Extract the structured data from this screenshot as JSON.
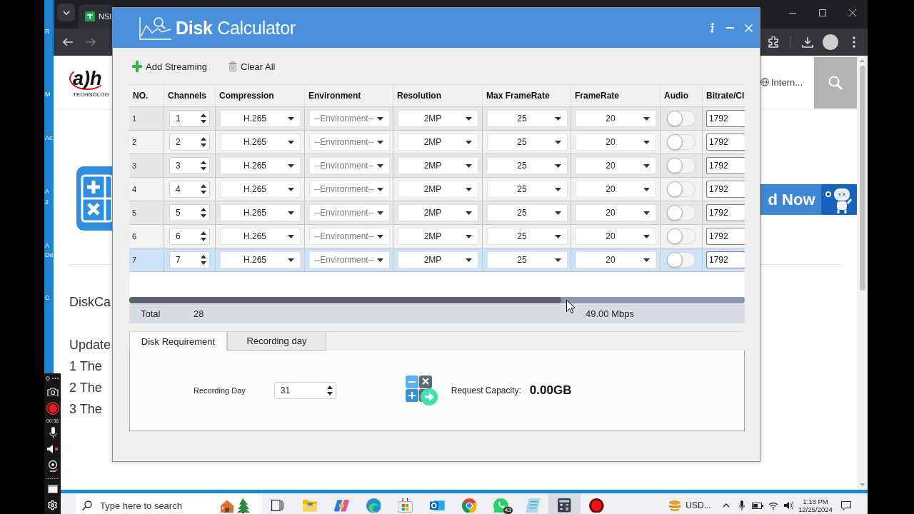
{
  "desktop": {
    "icon_labels": [
      "R",
      "M",
      "Ac",
      "A",
      "2",
      "A",
      "De",
      "C"
    ]
  },
  "browser": {
    "tab": {
      "title": "NSI"
    },
    "page": {
      "logo": {
        "text": "a)h",
        "tagline": "TECHNOLOG"
      },
      "search_scope": "Intern...",
      "banner": "d Now",
      "texts": [
        "DiskCa",
        "Update",
        "1 The",
        "2 The",
        "3 The"
      ]
    }
  },
  "dialog": {
    "title": "**Disk** Calculator",
    "toolbar": [
      {
        "kind": "add",
        "label": "Add Streaming"
      },
      {
        "kind": "clear",
        "label": "Clear All"
      }
    ],
    "table": {
      "columns": [
        "NO.",
        "Channels",
        "Compression",
        "Environment",
        "Resolution",
        "Max FrameRate",
        "FrameRate",
        "Audio",
        "Bitrate/Cl"
      ],
      "rows": [
        {
          "no": "1",
          "channels": "1",
          "compression": "H.265",
          "environment": {
            "placeholder": "--Environment--"
          },
          "resolution": "2MP",
          "max_framerate": "25",
          "framerate": "20",
          "audio": false,
          "bitrate": "1792",
          "selected": false
        },
        {
          "no": "2",
          "channels": "2",
          "compression": "H.265",
          "environment": {
            "placeholder": "--Environment--"
          },
          "resolution": "2MP",
          "max_framerate": "25",
          "framerate": "20",
          "audio": false,
          "bitrate": "1792",
          "selected": false
        },
        {
          "no": "3",
          "channels": "3",
          "compression": "H.265",
          "environment": {
            "placeholder": "--Environment--"
          },
          "resolution": "2MP",
          "max_framerate": "25",
          "framerate": "20",
          "audio": false,
          "bitrate": "1792",
          "selected": false
        },
        {
          "no": "4",
          "channels": "4",
          "compression": "H.265",
          "environment": {
            "placeholder": "--Environment--"
          },
          "resolution": "2MP",
          "max_framerate": "25",
          "framerate": "20",
          "audio": false,
          "bitrate": "1792",
          "selected": false
        },
        {
          "no": "5",
          "channels": "5",
          "compression": "H.265",
          "environment": {
            "placeholder": "--Environment--"
          },
          "resolution": "2MP",
          "max_framerate": "25",
          "framerate": "20",
          "audio": false,
          "bitrate": "1792",
          "selected": false
        },
        {
          "no": "6",
          "channels": "6",
          "compression": "H.265",
          "environment": {
            "placeholder": "--Environment--"
          },
          "resolution": "2MP",
          "max_framerate": "25",
          "framerate": "20",
          "audio": false,
          "bitrate": "1792",
          "selected": false
        },
        {
          "no": "7",
          "channels": "7",
          "compression": "H.265",
          "environment": {
            "placeholder": "--Environment--"
          },
          "resolution": "2MP",
          "max_framerate": "25",
          "framerate": "20",
          "audio": false,
          "bitrate": "1792",
          "selected": true
        }
      ]
    },
    "total": {
      "label": "Total",
      "channels": "28",
      "bitrate": "49.00 Mbps"
    },
    "tabs": [
      {
        "label": "Disk Requirement",
        "selected": true
      },
      {
        "label": "Recording day",
        "selected": false
      }
    ],
    "panel": {
      "recording_day_label": "Recording Day",
      "recording_day": "31",
      "capacity_label": "Request Capacity:",
      "capacity": "0.00GB"
    }
  },
  "recorder": {
    "elapsed": "00:36"
  },
  "taskbar": {
    "search": {
      "placeholder": "Type here to search"
    },
    "apps": [
      {
        "kind": "taskview",
        "selected": false
      },
      {
        "kind": "explorer",
        "selected": false
      },
      {
        "kind": "copilot",
        "selected": false
      },
      {
        "kind": "edge",
        "selected": false
      },
      {
        "kind": "store",
        "selected": false
      },
      {
        "kind": "outlook",
        "selected": false
      },
      {
        "kind": "chrome",
        "selected": false
      },
      {
        "kind": "whatsapp",
        "selected": false,
        "badge": "43"
      },
      {
        "kind": "notes",
        "selected": false
      },
      {
        "kind": "calculator",
        "selected": true
      },
      {
        "kind": "recorder",
        "selected": false
      }
    ],
    "tray": {
      "currency": "USD...",
      "time": "1:13 PM",
      "date": "12/25/2024"
    }
  }
}
